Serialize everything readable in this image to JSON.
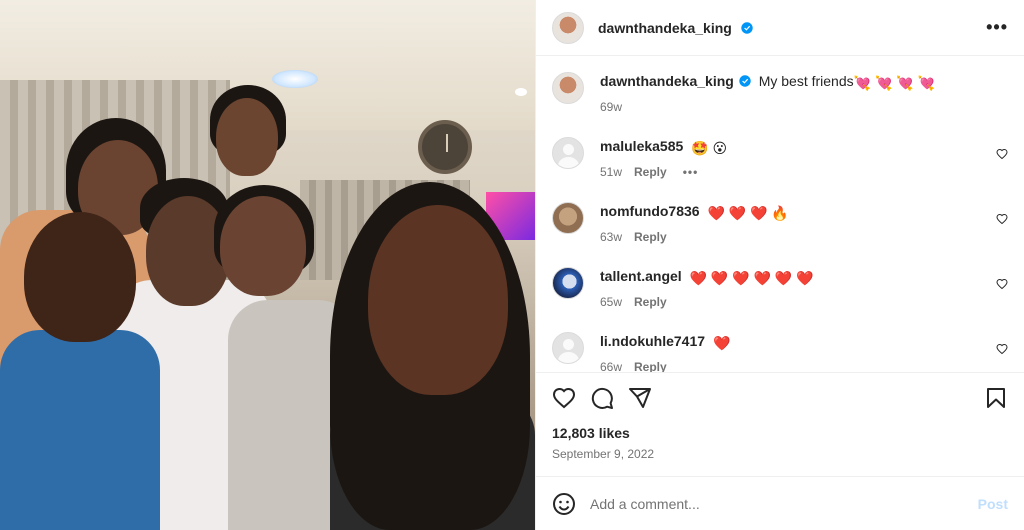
{
  "post": {
    "author": "dawnthandeka_king",
    "caption_text": "My best friends",
    "caption_hearts": "💘 💘 💘 💘",
    "caption_age": "69w",
    "likes": "12,803 likes",
    "date": "September 9, 2022",
    "more_label": "•••"
  },
  "comments": [
    {
      "user": "maluleka585",
      "text": "🤩 😮",
      "age": "51w",
      "reply": "Reply",
      "more": "•••"
    },
    {
      "user": "nomfundo7836",
      "text": "❤️ ❤️ ❤️ 🔥",
      "age": "63w",
      "reply": "Reply"
    },
    {
      "user": "tallent.angel",
      "text": "❤️ ❤️ ❤️ ❤️ ❤️ ❤️",
      "age": "65w",
      "reply": "Reply"
    },
    {
      "user": "li.ndokuhle7417",
      "text": "❤️",
      "age": "66w",
      "reply": "Reply"
    }
  ],
  "composer": {
    "placeholder": "Add a comment...",
    "post_label": "Post"
  },
  "colors": {
    "verified": "#0095f6",
    "muted": "#737373",
    "post_disabled": "#c0dffd"
  },
  "icons": [
    "verified-badge-icon",
    "more-options-icon",
    "heart-icon",
    "comment-icon",
    "share-icon",
    "bookmark-icon",
    "emoji-icon"
  ]
}
